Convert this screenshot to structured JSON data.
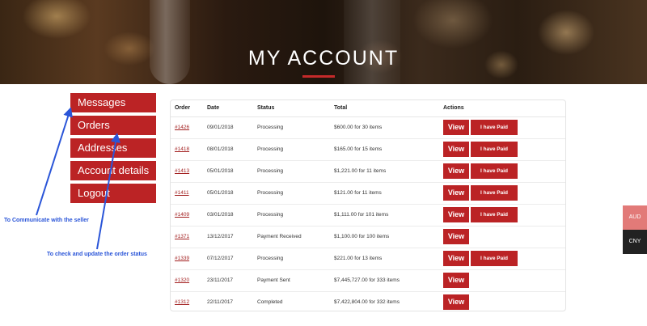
{
  "hero": {
    "title": "MY ACCOUNT"
  },
  "sidebar": {
    "items": [
      {
        "label": "Messages"
      },
      {
        "label": "Orders"
      },
      {
        "label": "Addresses"
      },
      {
        "label": "Account details"
      },
      {
        "label": "Logout"
      }
    ]
  },
  "annotations": {
    "messages_note": "To Communicate with the seller",
    "orders_note": "To check and update the order status"
  },
  "orders_table": {
    "headers": {
      "order": "Order",
      "date": "Date",
      "status": "Status",
      "total": "Total",
      "actions": "Actions"
    },
    "view_label": "View",
    "paid_label": "I have Paid",
    "rows": [
      {
        "order": "#1426",
        "date": "09/01/2018",
        "status": "Processing",
        "total": "$600.00 for 30 items",
        "paid": true
      },
      {
        "order": "#1418",
        "date": "08/01/2018",
        "status": "Processing",
        "total": "$165.00 for 15 items",
        "paid": true
      },
      {
        "order": "#1413",
        "date": "05/01/2018",
        "status": "Processing",
        "total": "$1,221.00 for 11 items",
        "paid": true
      },
      {
        "order": "#1411",
        "date": "05/01/2018",
        "status": "Processing",
        "total": "$121.00 for 11 items",
        "paid": true
      },
      {
        "order": "#1409",
        "date": "03/01/2018",
        "status": "Processing",
        "total": "$1,111.00 for 101 items",
        "paid": true
      },
      {
        "order": "#1371",
        "date": "13/12/2017",
        "status": "Payment Received",
        "total": "$1,100.00 for 100 items",
        "paid": false
      },
      {
        "order": "#1339",
        "date": "07/12/2017",
        "status": "Processing",
        "total": "$221.00 for 13 items",
        "paid": true
      },
      {
        "order": "#1320",
        "date": "23/11/2017",
        "status": "Payment Sent",
        "total": "$7,445,727.00 for 333 items",
        "paid": false
      },
      {
        "order": "#1312",
        "date": "22/11/2017",
        "status": "Completed",
        "total": "$7,422,804.00 for 332 items",
        "paid": false
      }
    ]
  },
  "currency_switcher": {
    "items": [
      {
        "label": "AUD",
        "color": "#e27a78"
      },
      {
        "label": "CNY",
        "color": "#222222"
      }
    ]
  },
  "colors": {
    "accent": "#bb2325",
    "annotation": "#2a55d8"
  }
}
